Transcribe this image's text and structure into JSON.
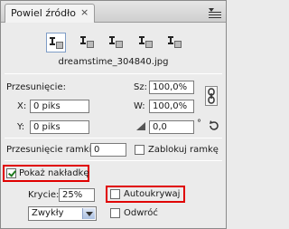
{
  "panel": {
    "tab_title": "Powiel źródło",
    "close_glyph": "×"
  },
  "sources": {
    "icon": "clone-source-icon",
    "active_index": 0,
    "count": 5
  },
  "filename": "dreamstime_304840.jpg",
  "offset": {
    "heading": "Przesunięcie:",
    "x_label": "X:",
    "x_value": "0 piks",
    "y_label": "Y:",
    "y_value": "0 piks",
    "width_label": "Sz:",
    "width_value": "100,0%",
    "height_label": "W:",
    "height_value": "100,0%",
    "angle_value": "0,0",
    "angle_unit": "°"
  },
  "frame_offset": {
    "label": "Przesunięcie ramki:",
    "value": "0",
    "lock_label": "Zablokuj ramkę",
    "lock_checked": false
  },
  "overlay": {
    "show_label": "Pokaż nakładkę",
    "show_checked": true,
    "opacity_label": "Krycie:",
    "opacity_value": "25%",
    "autohide_label": "Autoukrywaj",
    "autohide_checked": false,
    "mode_value": "Zwykły",
    "invert_label": "Odwróć",
    "invert_checked": false
  },
  "colors": {
    "highlight_border": "#e00000",
    "active_source_border": "#7f9dc7"
  }
}
